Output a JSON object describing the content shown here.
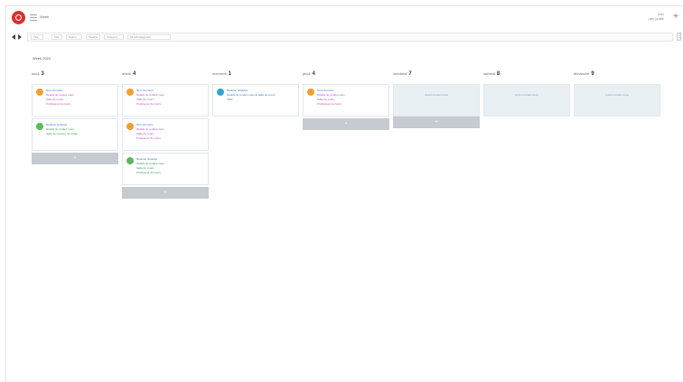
{
  "header": {
    "app_title": "Week",
    "user_name": "user",
    "user_sub": "user profile",
    "add_glyph": "+"
  },
  "toolbar": {
    "prev_label": "previous",
    "next_label": "next",
    "filters": [
      "Title",
      "Title",
      "Status",
      "Teacher",
      "Category",
      "All subcategories"
    ]
  },
  "week_label": "Week 2022",
  "columns": [
    {
      "day": "lundi",
      "count": "3"
    },
    {
      "day": "mardi",
      "count": "4"
    },
    {
      "day": "mercredi",
      "count": "1"
    },
    {
      "day": "jeudi",
      "count": "4"
    },
    {
      "day": "vendredi",
      "count": "7"
    },
    {
      "day": "samedi",
      "count": "8"
    },
    {
      "day": "dimanche",
      "count": "9"
    }
  ],
  "cards": {
    "c1_title": "Nom du cours",
    "c1_line2": "Détails du rendez-vous",
    "c1_line3": "Salle de cours",
    "c1_line4": "Professeur du cours",
    "c2_title": "Réunion d'équipe",
    "c2_line2": "Détails du rendez-vous",
    "c2_line3": "Salle de réunion, 2e étage",
    "c3_title": "Nom du cours",
    "c3_line2": "Détails du rendez-vous",
    "c3_line3": "Salle de cours",
    "c3_line4": "Professeur du cours",
    "c4_title": "Nom du cours",
    "c4_line2": "Détails du rendez-vous",
    "c4_line3": "Salle de cours",
    "c4_line4": "Professeur du cours",
    "c5_title": "Réunion d'équipe",
    "c5_line2": "Détails du rendez-vous",
    "c5_line3": "Salle de cours",
    "c5_line4": "Professeur du cours",
    "c6_title": "Réunion d'équipe",
    "c6_line2": "Détails du rendez-vous",
    "c6_line3": "Salle de réunion, 2e étage",
    "c7_title": "Réunion d'équipe",
    "c7_line2": "Détails du rendez-vous et salle du cours",
    "c7_line3": "Salle",
    "c8_title": "Nom du cours",
    "c8_line2": "Détails du rendez-vous",
    "c8_line3": "Salle de cours",
    "c8_line4": "Professeur du cours"
  },
  "empty_label": "Aucun rendez-vous",
  "add_label": "+"
}
